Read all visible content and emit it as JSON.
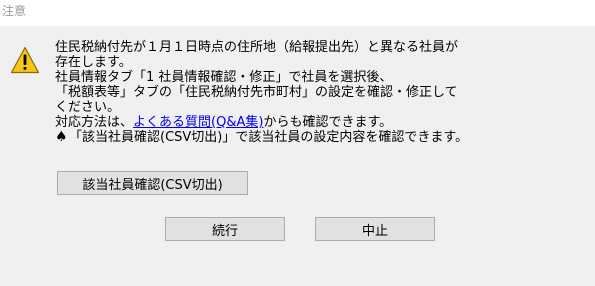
{
  "window": {
    "title": "注意"
  },
  "dialog": {
    "icon": "warning-icon",
    "message_lines": [
      "住民税納付先が１月１日時点の住所地（給報提出先）と異なる社員が",
      "存在します。",
      "社員情報タブ「1 社員情報確認・修正」で社員を選択後、",
      "「税額表等」タブの「住民税納付先市町村」の設定を確認・修正して",
      "ください。"
    ],
    "faq_prefix": "対応方法は、",
    "faq_link": "よくある質問(Q&A集)",
    "faq_suffix": "からも確認できます。",
    "spade_symbol": "♠",
    "spade_text": "「該当社員確認(CSV切出)」で該当社員の設定内容を確認できます。"
  },
  "buttons": {
    "csv": "該当社員確認(CSV切出)",
    "continue": "続行",
    "cancel": "中止"
  },
  "colors": {
    "title_text": "#9a9a9a",
    "link": "#0000ee",
    "warning_fill": "#f5c518",
    "background": "#f0f0f0"
  }
}
